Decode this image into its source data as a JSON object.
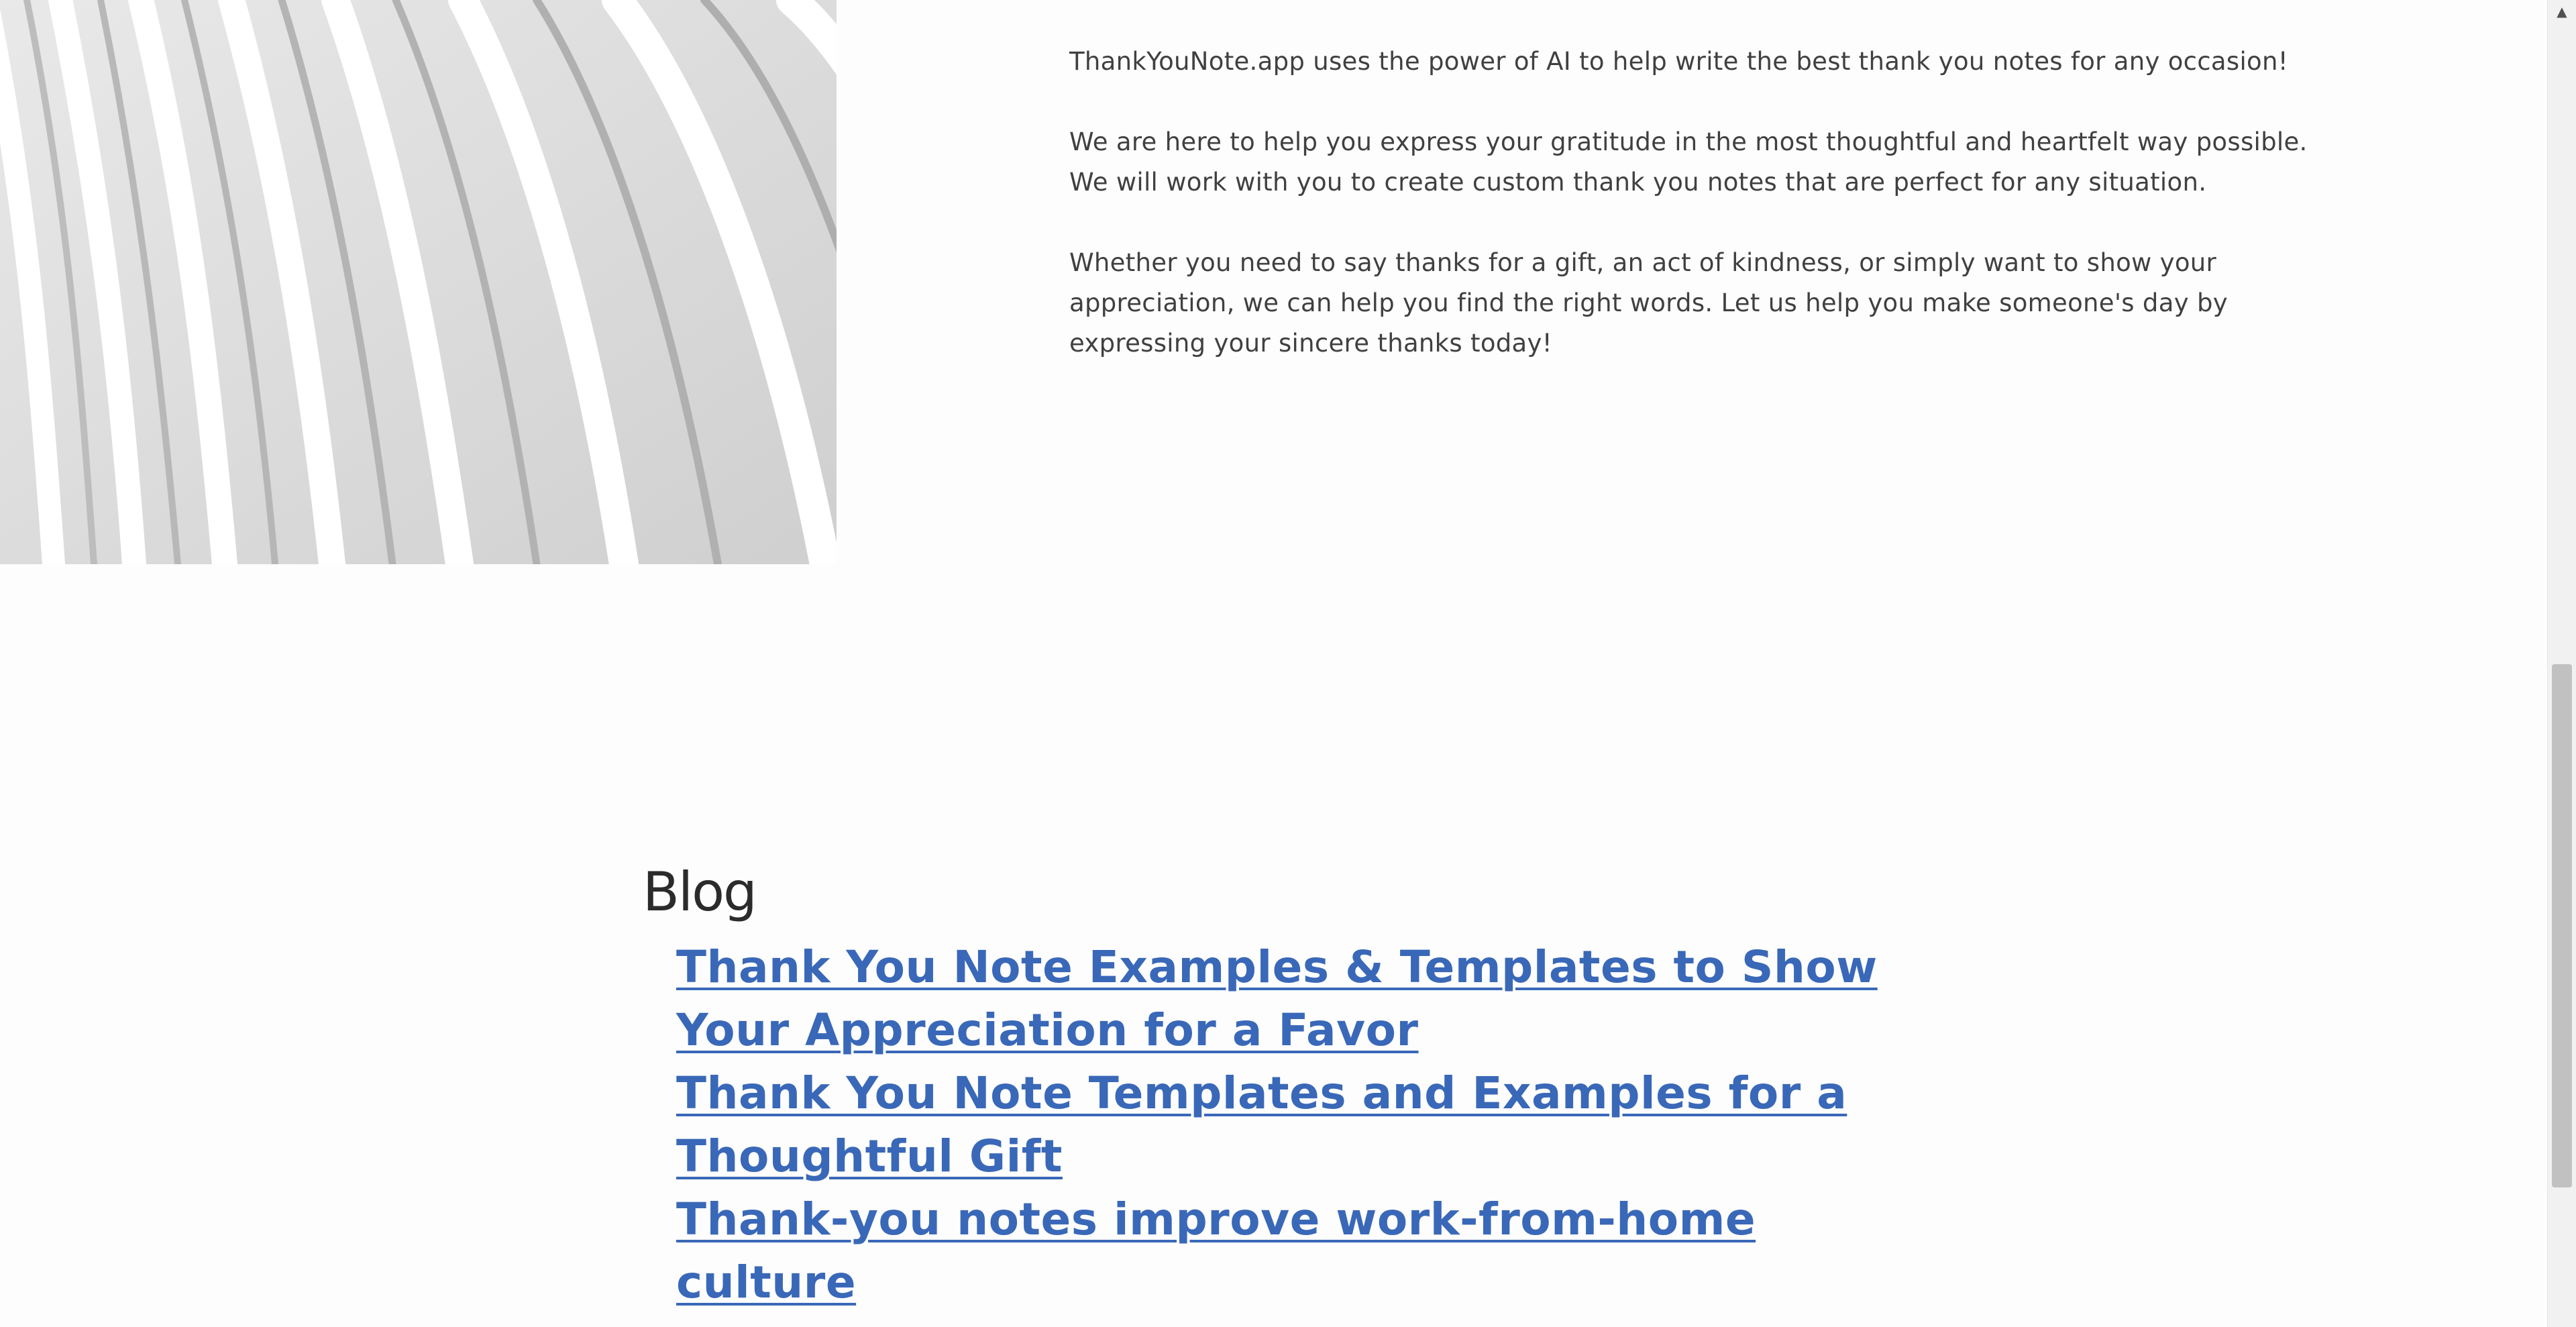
{
  "about": {
    "paragraph_1": "ThankYouNote.app uses the power of AI to help write the best thank you notes for any occasion!",
    "paragraph_2_line_1": "We are here to help you express your gratitude in the most thoughtful and heartfelt way possible.",
    "paragraph_2_line_2": "We will work with you to create custom thank you notes that are perfect for any situation.",
    "paragraph_3": "Whether you need to say thanks for a gift, an act of kindness, or simply want to show your appreciation, we can help you find the right words. Let us help you make someone's day by expressing your sincere thanks today!"
  },
  "blog": {
    "heading": "Blog",
    "posts": [
      {
        "title": "Thank You Note Examples & Templates to Show Your Appreciation for a Favor"
      },
      {
        "title": "Thank You Note Templates and Examples for a Thoughtful Gift"
      },
      {
        "title": "Thank-you notes improve work-from-home culture"
      }
    ]
  },
  "colors": {
    "link": "#3a68b8",
    "text": "#404040",
    "background": "#fdfdfd"
  }
}
